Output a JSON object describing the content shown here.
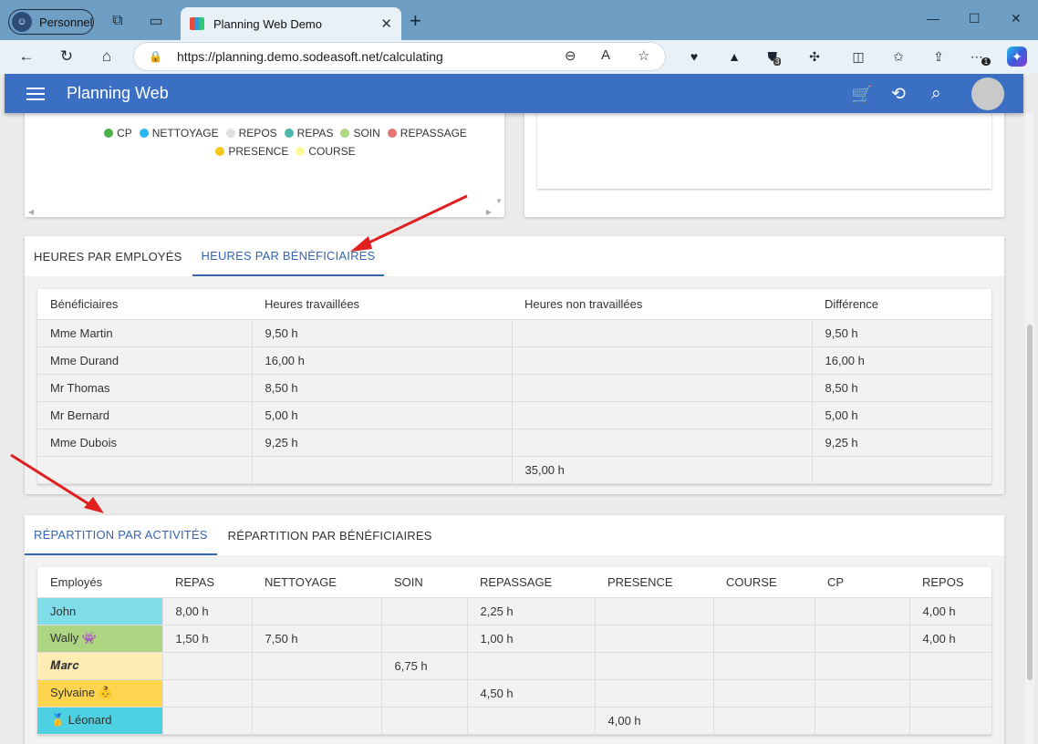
{
  "browser": {
    "profile": "Personnel",
    "tab_title": "Planning Web Demo",
    "url": "https://planning.demo.sodeasoft.net/calculating"
  },
  "extensions": {
    "badge_a": "3",
    "badge_b": "1"
  },
  "app": {
    "title": "Planning Web"
  },
  "legend": [
    {
      "label": "CP",
      "color": "#4caf50"
    },
    {
      "label": "NETTOYAGE",
      "color": "#29b6f6"
    },
    {
      "label": "REPOS",
      "color": "#e0e0e0"
    },
    {
      "label": "REPAS",
      "color": "#4db6ac"
    },
    {
      "label": "SOIN",
      "color": "#aed581"
    },
    {
      "label": "REPASSAGE",
      "color": "#e57373"
    },
    {
      "label": "PRESENCE",
      "color": "#f5c518"
    },
    {
      "label": "COURSE",
      "color": "#fff59d"
    }
  ],
  "hours_tabs": [
    "HEURES PAR EMPLOYÉS",
    "HEURES PAR BÉNÉFICIAIRES"
  ],
  "beneficiaires_table": {
    "headers": [
      "Bénéficiaires",
      "Heures travaillées",
      "Heures non travaillées",
      "Différence"
    ],
    "rows": [
      [
        "Mme Martin",
        "9,50 h",
        "",
        "9,50 h"
      ],
      [
        "Mme Durand",
        "16,00 h",
        "",
        "16,00 h"
      ],
      [
        "Mr Thomas",
        "8,50 h",
        "",
        "8,50 h"
      ],
      [
        "Mr Bernard",
        "5,00 h",
        "",
        "5,00 h"
      ],
      [
        "Mme Dubois",
        "9,25 h",
        "",
        "9,25 h"
      ],
      [
        "",
        "",
        "35,00 h",
        ""
      ]
    ]
  },
  "repartition_tabs": [
    "RÉPARTITION PAR ACTIVITÉS",
    "RÉPARTITION PAR BÉNÉFICIAIRES"
  ],
  "activites_table": {
    "headers": [
      "Employés",
      "REPAS",
      "NETTOYAGE",
      "SOIN",
      "REPASSAGE",
      "PRESENCE",
      "COURSE",
      "CP",
      "REPOS"
    ],
    "rows": [
      {
        "name": "John",
        "color": "#80deea",
        "cells": [
          "8,00 h",
          "",
          "",
          "2,25 h",
          "",
          "",
          "",
          "4,00 h"
        ]
      },
      {
        "name": "Wally 👾",
        "color": "#aed581",
        "cells": [
          "1,50 h",
          "7,50 h",
          "",
          "1,00 h",
          "",
          "",
          "",
          "4,00 h"
        ]
      },
      {
        "name": "𝑴𝒂𝒓𝒄",
        "color": "#ffecb3",
        "cells": [
          "",
          "",
          "6,75 h",
          "",
          "",
          "",
          "",
          ""
        ]
      },
      {
        "name": "Sylvaine 👶",
        "color": "#ffd54f",
        "cells": [
          "",
          "",
          "",
          "4,50 h",
          "",
          "",
          "",
          ""
        ]
      },
      {
        "name": "🥇 Léonard",
        "color": "#4dd0e1",
        "cells": [
          "",
          "",
          "",
          "",
          "4,00 h",
          "",
          "",
          ""
        ]
      }
    ]
  }
}
